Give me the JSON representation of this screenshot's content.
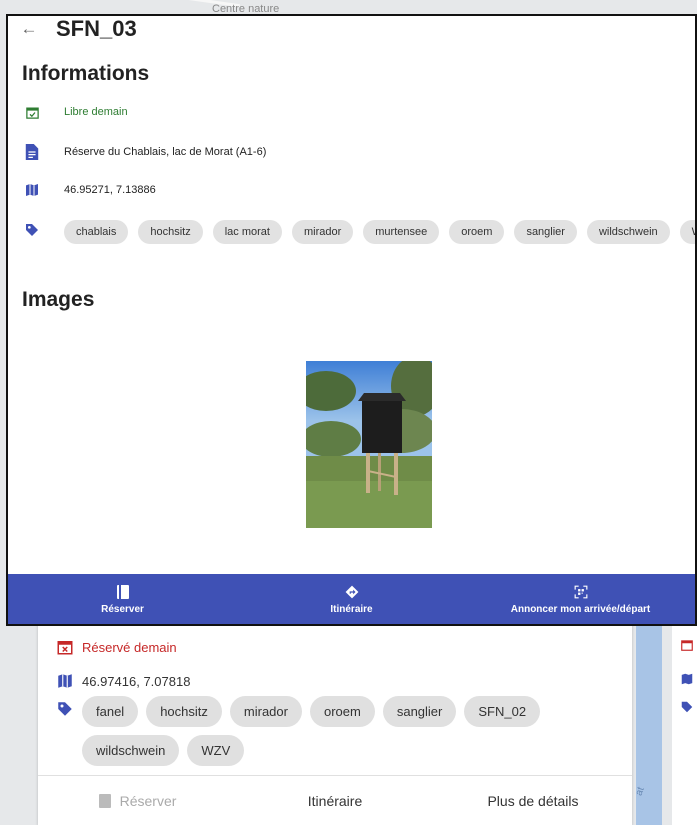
{
  "map": {
    "label": "Centre nature",
    "river_label": "at"
  },
  "dialog": {
    "title": "SFN_03",
    "sections": {
      "informations": "Informations",
      "images": "Images"
    },
    "availability": "Libre demain",
    "description": "Réserve du Chablais, lac de Morat (A1-6)",
    "coordinates": "46.95271, 7.13886",
    "tags": [
      "chablais",
      "hochsitz",
      "lac morat",
      "mirador",
      "murtensee",
      "oroem",
      "sanglier",
      "wildschwein",
      "WZV"
    ],
    "actions": {
      "reserve": "Réserver",
      "itinerary": "Itinéraire",
      "announce": "Annoncer mon arrivée/départ"
    }
  },
  "background_card": {
    "status": "Réservé demain",
    "coordinates": "46.97416, 7.07818",
    "tags": [
      "fanel",
      "hochsitz",
      "mirador",
      "oroem",
      "sanglier",
      "SFN_02",
      "wildschwein",
      "WZV"
    ],
    "actions": {
      "reserve": "Réserver",
      "itinerary": "Itinéraire",
      "details": "Plus de détails"
    }
  },
  "colors": {
    "primary": "#3f51b5",
    "available": "#2e7d32",
    "reserved": "#c62828"
  }
}
